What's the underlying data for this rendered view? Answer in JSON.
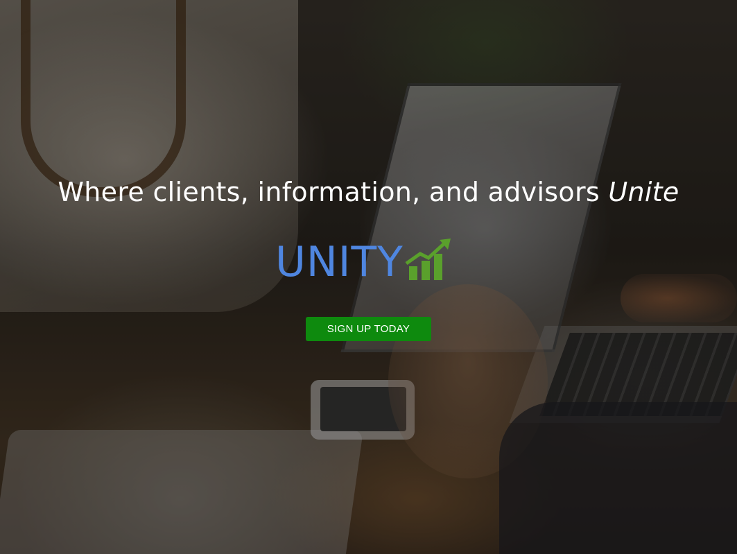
{
  "hero": {
    "headline_main": "Where clients, information, and advisors ",
    "headline_emphasis": "Unite",
    "background_description_icon": "office-meeting-photo",
    "overlay_color": "#000000"
  },
  "logo": {
    "text": "UNITY",
    "text_color": "#4f86e0",
    "icon": "bar-chart-up-arrow-icon",
    "icon_color": "#5aa02c"
  },
  "cta": {
    "label": "SIGN UP TODAY",
    "background_color": "#0e8a0e"
  }
}
